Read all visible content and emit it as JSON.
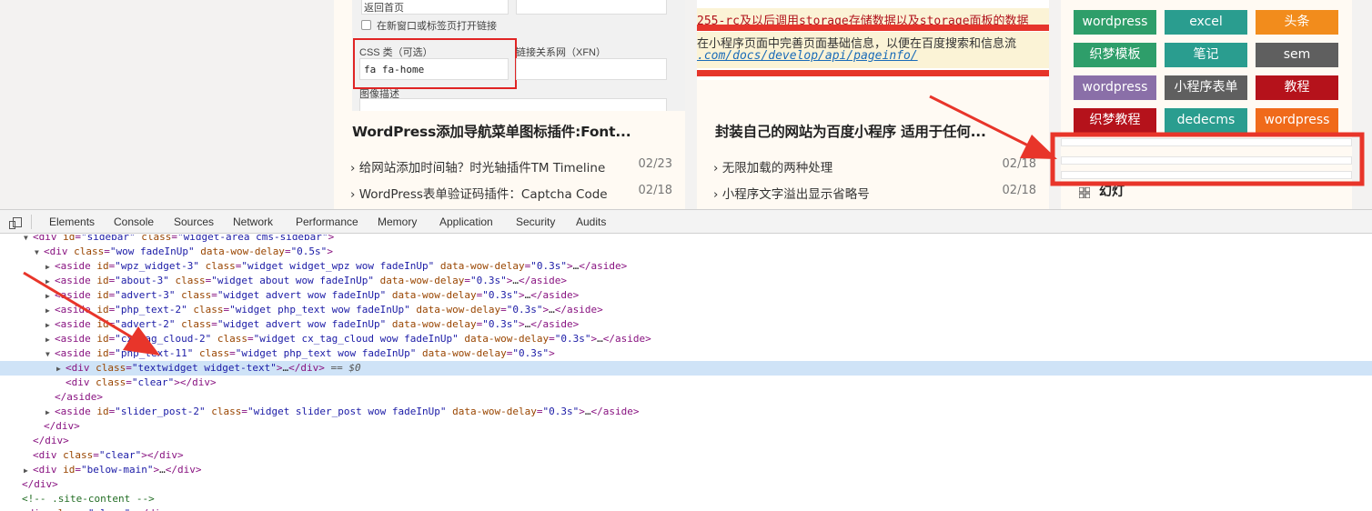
{
  "card1": {
    "form": {
      "go_home": "返回首页",
      "new_tab_label": "在新窗口或标签页打开链接",
      "css_class_label": "CSS 类（可选）",
      "css_class_value": "fa fa-home",
      "xfn_label": "链接关系网（XFN）",
      "desc_label": "图像描述"
    },
    "title": "WordPress添加导航菜单图标插件:Font...",
    "items": [
      {
        "text": "› 给网站添加时间轴？时光轴插件TM Timeline",
        "date": "02/23"
      },
      {
        "text": "› WordPress表单验证码插件：Captcha Code",
        "date": "02/18"
      }
    ]
  },
  "card2": {
    "code": {
      "line1": "255-rc及以后调用storage存储数据以及storage面板的数据",
      "line2": "在小程序页面中完善页面基础信息，以便在百度搜索和信息流",
      "line3": ".com/docs/develop/api/pageinfo/"
    },
    "title": "封装自己的网站为百度小程序 适用于任何...",
    "items": [
      {
        "text": "› 无限加载的两种处理",
        "date": "02/18"
      },
      {
        "text": "› 小程序文字溢出显示省略号",
        "date": "02/18"
      }
    ]
  },
  "sidebar": {
    "tags": [
      {
        "label": "wordpress",
        "color": "#2e9e6a"
      },
      {
        "label": "excel",
        "color": "#2a9d8f"
      },
      {
        "label": "头条",
        "color": "#f28c1c"
      },
      {
        "label": "织梦模板",
        "color": "#2e9e6a"
      },
      {
        "label": "笔记",
        "color": "#2a9d8f"
      },
      {
        "label": "sem",
        "color": "#5f5f5f"
      },
      {
        "label": "wordpress",
        "color": "#8a6fa8"
      },
      {
        "label": "小程序表单",
        "color": "#5f5f5f"
      },
      {
        "label": "教程",
        "color": "#b5121b"
      },
      {
        "label": "织梦教程",
        "color": "#b5121b"
      },
      {
        "label": "dedecms",
        "color": "#2a9d8f"
      },
      {
        "label": "wordpress",
        "color": "#f06a1a"
      }
    ],
    "slider_title": "幻灯"
  },
  "devtools": {
    "tabs": [
      "Elements",
      "Console",
      "Sources",
      "Network",
      "Performance",
      "Memory",
      "Application",
      "Security",
      "Audits"
    ],
    "lines": [
      {
        "tri": "▼",
        "parts": [
          [
            "tg",
            "<div "
          ],
          [
            "an",
            "id"
          ],
          [
            "tg",
            "="
          ],
          [
            "av",
            "\"sidebar\""
          ],
          [
            "tg",
            " "
          ],
          [
            "an",
            "class"
          ],
          [
            "tg",
            "="
          ],
          [
            "av",
            "\"widget-area cms-sidebar\""
          ],
          [
            "tg",
            ">"
          ]
        ]
      },
      {
        "tri": "▼",
        "parts": [
          [
            "tg",
            "<div "
          ],
          [
            "an",
            "class"
          ],
          [
            "tg",
            "="
          ],
          [
            "av",
            "\"wow fadeInUp\""
          ],
          [
            "tg",
            " "
          ],
          [
            "an",
            "data-wow-delay"
          ],
          [
            "tg",
            "="
          ],
          [
            "av",
            "\"0.5s\""
          ],
          [
            "tg",
            ">"
          ]
        ]
      },
      {
        "tri": "▶",
        "parts": [
          [
            "tg",
            "<aside "
          ],
          [
            "an",
            "id"
          ],
          [
            "tg",
            "="
          ],
          [
            "av",
            "\"wpz_widget-3\""
          ],
          [
            "tg",
            " "
          ],
          [
            "an",
            "class"
          ],
          [
            "tg",
            "="
          ],
          [
            "av",
            "\"widget widget_wpz wow fadeInUp\""
          ],
          [
            "tg",
            " "
          ],
          [
            "an",
            "data-wow-delay"
          ],
          [
            "tg",
            "="
          ],
          [
            "av",
            "\"0.3s\""
          ],
          [
            "tg",
            ">"
          ],
          [
            "tx",
            "…"
          ],
          [
            "tg",
            "</aside>"
          ]
        ]
      },
      {
        "tri": "▶",
        "parts": [
          [
            "tg",
            "<aside "
          ],
          [
            "an",
            "id"
          ],
          [
            "tg",
            "="
          ],
          [
            "av",
            "\"about-3\""
          ],
          [
            "tg",
            " "
          ],
          [
            "an",
            "class"
          ],
          [
            "tg",
            "="
          ],
          [
            "av",
            "\"widget about wow fadeInUp\""
          ],
          [
            "tg",
            " "
          ],
          [
            "an",
            "data-wow-delay"
          ],
          [
            "tg",
            "="
          ],
          [
            "av",
            "\"0.3s\""
          ],
          [
            "tg",
            ">"
          ],
          [
            "tx",
            "…"
          ],
          [
            "tg",
            "</aside>"
          ]
        ]
      },
      {
        "tri": "▶",
        "parts": [
          [
            "tg",
            "<aside "
          ],
          [
            "an",
            "id"
          ],
          [
            "tg",
            "="
          ],
          [
            "av",
            "\"advert-3\""
          ],
          [
            "tg",
            " "
          ],
          [
            "an",
            "class"
          ],
          [
            "tg",
            "="
          ],
          [
            "av",
            "\"widget advert wow fadeInUp\""
          ],
          [
            "tg",
            " "
          ],
          [
            "an",
            "data-wow-delay"
          ],
          [
            "tg",
            "="
          ],
          [
            "av",
            "\"0.3s\""
          ],
          [
            "tg",
            ">"
          ],
          [
            "tx",
            "…"
          ],
          [
            "tg",
            "</aside>"
          ]
        ]
      },
      {
        "tri": "▶",
        "parts": [
          [
            "tg",
            "<aside "
          ],
          [
            "an",
            "id"
          ],
          [
            "tg",
            "="
          ],
          [
            "av",
            "\"php_text-2\""
          ],
          [
            "tg",
            " "
          ],
          [
            "an",
            "class"
          ],
          [
            "tg",
            "="
          ],
          [
            "av",
            "\"widget php_text wow fadeInUp\""
          ],
          [
            "tg",
            " "
          ],
          [
            "an",
            "data-wow-delay"
          ],
          [
            "tg",
            "="
          ],
          [
            "av",
            "\"0.3s\""
          ],
          [
            "tg",
            ">"
          ],
          [
            "tx",
            "…"
          ],
          [
            "tg",
            "</aside>"
          ]
        ]
      },
      {
        "tri": "▶",
        "parts": [
          [
            "tg",
            "<aside "
          ],
          [
            "an",
            "id"
          ],
          [
            "tg",
            "="
          ],
          [
            "av",
            "\"advert-2\""
          ],
          [
            "tg",
            " "
          ],
          [
            "an",
            "class"
          ],
          [
            "tg",
            "="
          ],
          [
            "av",
            "\"widget advert wow fadeInUp\""
          ],
          [
            "tg",
            " "
          ],
          [
            "an",
            "data-wow-delay"
          ],
          [
            "tg",
            "="
          ],
          [
            "av",
            "\"0.3s\""
          ],
          [
            "tg",
            ">"
          ],
          [
            "tx",
            "…"
          ],
          [
            "tg",
            "</aside>"
          ]
        ]
      },
      {
        "tri": "▶",
        "parts": [
          [
            "tg",
            "<aside "
          ],
          [
            "an",
            "id"
          ],
          [
            "tg",
            "="
          ],
          [
            "av",
            "\"cx_tag_cloud-2\""
          ],
          [
            "tg",
            " "
          ],
          [
            "an",
            "class"
          ],
          [
            "tg",
            "="
          ],
          [
            "av",
            "\"widget cx_tag_cloud wow fadeInUp\""
          ],
          [
            "tg",
            " "
          ],
          [
            "an",
            "data-wow-delay"
          ],
          [
            "tg",
            "="
          ],
          [
            "av",
            "\"0.3s\""
          ],
          [
            "tg",
            ">"
          ],
          [
            "tx",
            "…"
          ],
          [
            "tg",
            "</aside>"
          ]
        ]
      },
      {
        "tri": "▼",
        "parts": [
          [
            "tg",
            "<aside "
          ],
          [
            "an",
            "id"
          ],
          [
            "tg",
            "="
          ],
          [
            "av",
            "\"php_text-11\""
          ],
          [
            "tg",
            " "
          ],
          [
            "an",
            "class"
          ],
          [
            "tg",
            "="
          ],
          [
            "av",
            "\"widget php_text wow fadeInUp\""
          ],
          [
            "tg",
            " "
          ],
          [
            "an",
            "data-wow-delay"
          ],
          [
            "tg",
            "="
          ],
          [
            "av",
            "\"0.3s\""
          ],
          [
            "tg",
            ">"
          ]
        ]
      },
      {
        "tri": "▶",
        "parts": [
          [
            "tg",
            "<div "
          ],
          [
            "an",
            "class"
          ],
          [
            "tg",
            "="
          ],
          [
            "av",
            "\"textwidget widget-text\""
          ],
          [
            "tg",
            ">"
          ],
          [
            "tx",
            "…"
          ],
          [
            "tg",
            "</div>"
          ],
          [
            "eq",
            " == $0"
          ]
        ]
      },
      {
        "tri": "",
        "parts": [
          [
            "tg",
            "<div "
          ],
          [
            "an",
            "class"
          ],
          [
            "tg",
            "="
          ],
          [
            "av",
            "\"clear\""
          ],
          [
            "tg",
            "></div>"
          ]
        ]
      },
      {
        "tri": "",
        "parts": [
          [
            "tg",
            "</aside>"
          ]
        ]
      },
      {
        "tri": "▶",
        "parts": [
          [
            "tg",
            "<aside "
          ],
          [
            "an",
            "id"
          ],
          [
            "tg",
            "="
          ],
          [
            "av",
            "\"slider_post-2\""
          ],
          [
            "tg",
            " "
          ],
          [
            "an",
            "class"
          ],
          [
            "tg",
            "="
          ],
          [
            "av",
            "\"widget slider_post wow fadeInUp\""
          ],
          [
            "tg",
            " "
          ],
          [
            "an",
            "data-wow-delay"
          ],
          [
            "tg",
            "="
          ],
          [
            "av",
            "\"0.3s\""
          ],
          [
            "tg",
            ">"
          ],
          [
            "tx",
            "…"
          ],
          [
            "tg",
            "</aside>"
          ]
        ]
      },
      {
        "tri": "",
        "parts": [
          [
            "tg",
            "</div>"
          ]
        ]
      },
      {
        "tri": "",
        "parts": [
          [
            "tg",
            "</div>"
          ]
        ]
      },
      {
        "tri": "",
        "parts": [
          [
            "tg",
            "<div "
          ],
          [
            "an",
            "class"
          ],
          [
            "tg",
            "="
          ],
          [
            "av",
            "\"clear\""
          ],
          [
            "tg",
            "></div>"
          ]
        ]
      },
      {
        "tri": "▶",
        "parts": [
          [
            "tg",
            "<div "
          ],
          [
            "an",
            "id"
          ],
          [
            "tg",
            "="
          ],
          [
            "av",
            "\"below-main\""
          ],
          [
            "tg",
            ">"
          ],
          [
            "tx",
            "…"
          ],
          [
            "tg",
            "</div>"
          ]
        ]
      },
      {
        "tri": "",
        "parts": [
          [
            "tg",
            "</div>"
          ]
        ]
      },
      {
        "tri": "",
        "parts": [
          [
            "cm",
            "<!-- .site-content -->"
          ]
        ]
      },
      {
        "tri": "",
        "parts": [
          [
            "tg",
            "<div "
          ],
          [
            "an",
            "class"
          ],
          [
            "tg",
            "="
          ],
          [
            "av",
            "\"clear\""
          ],
          [
            "tg",
            "></div>"
          ]
        ]
      }
    ]
  }
}
